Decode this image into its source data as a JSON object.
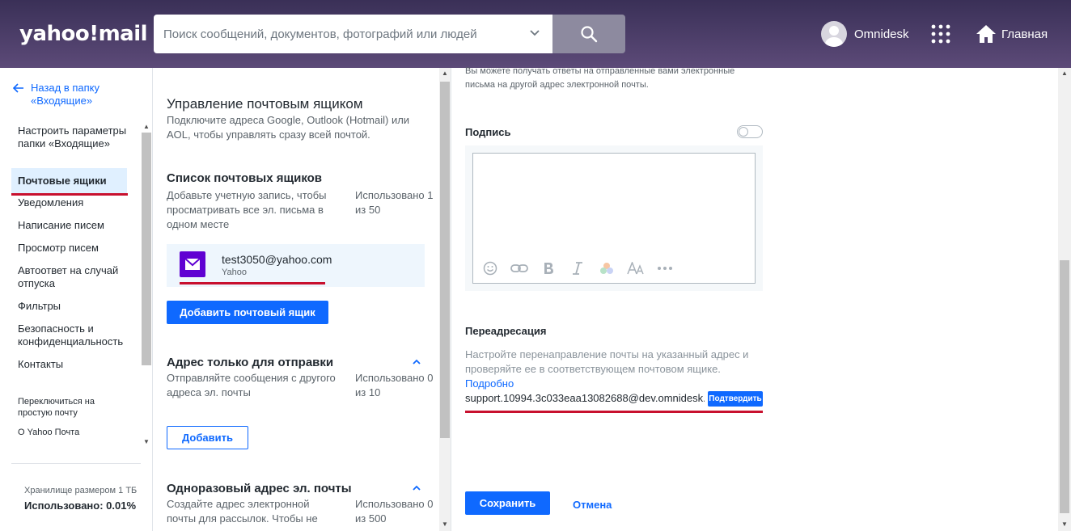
{
  "header": {
    "logo": "yahoo!mail",
    "search_placeholder": "Поиск сообщений, документов, фотографий или людей",
    "user_name": "Omnidesk",
    "home_label": "Главная"
  },
  "sidebar": {
    "back_link": "Назад в папку «Входящие»",
    "items": [
      {
        "label": "Настроить параметры папки «Входящие»",
        "active": false
      },
      {
        "label": "Почтовые ящики",
        "active": true
      },
      {
        "label": "Уведомления",
        "active": false
      },
      {
        "label": "Написание писем",
        "active": false
      },
      {
        "label": "Просмотр писем",
        "active": false
      },
      {
        "label": "Автоответ на случай отпуска",
        "active": false
      },
      {
        "label": "Фильтры",
        "active": false
      },
      {
        "label": "Безопасность и конфиденциальность",
        "active": false
      },
      {
        "label": "Контакты",
        "active": false
      }
    ],
    "secondary": [
      {
        "label": "Переключиться на простую почту"
      },
      {
        "label": "О Yahoo Почта"
      }
    ],
    "storage_size": "Хранилище размером 1 ТБ",
    "storage_used": "Использовано: 0.01%"
  },
  "mailboxes": {
    "title": "Управление почтовым ящиком",
    "description": "Подключите адреса Google, Outlook (Hotmail) или AOL, чтобы управлять сразу всей почтой.",
    "list": {
      "title": "Список почтовых ящиков",
      "description": "Добавьте учетную запись, чтобы просматривать все эл. письма в одном месте",
      "usage": "Использовано 1 из 50",
      "accounts": [
        {
          "email": "test3050@yahoo.com",
          "provider": "Yahoo"
        }
      ],
      "add_button": "Добавить почтовый ящик"
    },
    "send_only": {
      "title": "Адрес только для отправки",
      "description": "Отправляйте сообщения с другого адреса эл. почты",
      "usage": "Использовано 0 из 10",
      "add_button": "Добавить"
    },
    "disposable": {
      "title": "Одноразовый адрес эл. почты",
      "description": "Создайте адрес электронной почты для рассылок. Чтобы не",
      "usage": "Использовано 0 из 500"
    }
  },
  "details": {
    "reply_hint": "Вы можете получать ответы на отправленные вами электронные письма на другой адрес электронной почты.",
    "signature_label": "Подпись",
    "signature_enabled": false,
    "toolbar_icons": [
      "emoji-icon",
      "link-icon",
      "bold-icon",
      "italic-icon",
      "color-icon",
      "font-size-icon",
      "more-icon"
    ],
    "forwarding_label": "Переадресация",
    "forwarding_desc": "Настройте перенаправление почты на указанный адрес и проверяйте ее в соответствующем почтовом ящике.",
    "forwarding_more": "Подробно",
    "forwarding_address": "support.10994.3c033eaa13082688@dev.omnidesk.ru",
    "verify_button": "Подтвердить",
    "save_button": "Сохранить",
    "cancel_button": "Отмена"
  },
  "colors": {
    "header_bg": "#3a3057",
    "accent": "#0f69ff",
    "highlight_underline": "#c8102e",
    "mailbox_icon": "#6001d2"
  }
}
